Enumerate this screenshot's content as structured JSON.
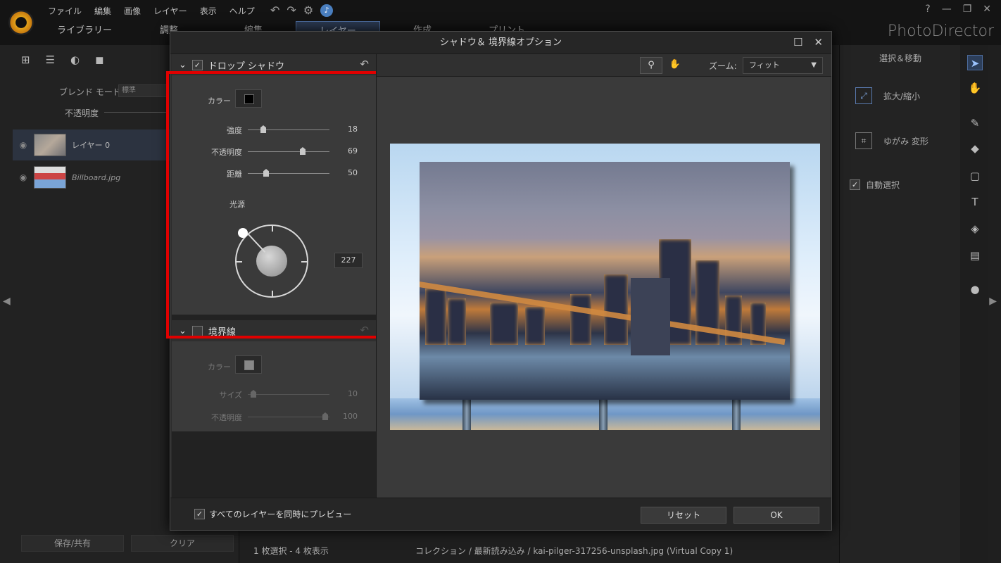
{
  "menu": [
    "ファイル",
    "編集",
    "画像",
    "レイヤー",
    "表示",
    "ヘルプ"
  ],
  "brand": "PhotoDirector",
  "win_help": "?",
  "mode_tabs": [
    "ライブラリー",
    "調整",
    "編集",
    "レイヤー",
    "作成",
    "プリント"
  ],
  "active_mode": "レイヤー",
  "left": {
    "blend_label": "ブレンド モード:",
    "blend_value": "標準",
    "opacity_label": "不透明度",
    "layers": [
      {
        "name": "レイヤー 0"
      },
      {
        "name": "Billboard.jpg"
      }
    ],
    "save_label": "保存/共有",
    "clear_label": "クリア"
  },
  "right": {
    "title": "選択＆移動",
    "zoom_label": "拡大/縮小",
    "warp_label": "ゆがみ 変形",
    "auto_select_label": "自動選択"
  },
  "dialog": {
    "title": "シャドウ＆ 境界線オプション",
    "drop_shadow": {
      "title": "ドロップ シャドウ",
      "color_label": "カラー",
      "strength_label": "強度",
      "strength": 18,
      "opacity_label": "不透明度",
      "opacity": 69,
      "distance_label": "距離",
      "distance": 50,
      "light_label": "光源",
      "angle": 227
    },
    "border": {
      "title": "境界線",
      "color_label": "カラー",
      "size_label": "サイズ",
      "size": 10,
      "opacity_label": "不透明度",
      "opacity": 100
    },
    "zoom_label": "ズーム:",
    "zoom_value": "フィット",
    "preview_all_label": "すべてのレイヤーを同時にプレビュー",
    "reset_label": "リセット",
    "ok_label": "OK"
  },
  "status": {
    "selection": "1 枚選択 - 4 枚表示",
    "path": "コレクション / 最新読み込み / kai-pilger-317256-unsplash.jpg (Virtual Copy 1)"
  },
  "colors": {
    "accent": "#4d6da0",
    "highlight": "#e00000",
    "shadow_color": "#000000"
  }
}
